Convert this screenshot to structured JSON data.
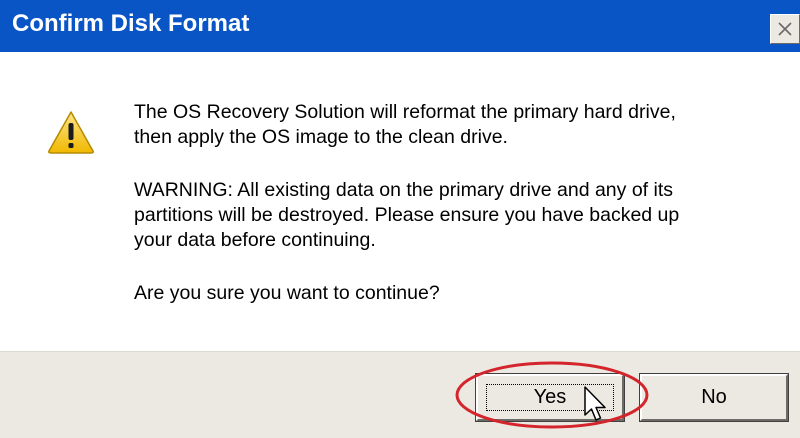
{
  "window": {
    "title": "Confirm Disk Format",
    "close_glyph": "✕"
  },
  "message": {
    "line1": "The OS Recovery Solution will reformat the primary hard drive,",
    "line2": "then apply the OS image to the clean drive.",
    "warning_line1": "WARNING: All existing data on the primary drive and any of its",
    "warning_line2": "partitions will be destroyed. Please ensure you have backed up",
    "warning_line3": "your data before continuing.",
    "question": "Are you sure you want to continue?"
  },
  "buttons": {
    "yes_label": "Yes",
    "no_label": "No"
  },
  "icons": {
    "warning": "warning-triangle-icon",
    "cursor": "mouse-pointer-icon",
    "highlight": "red-highlight-ellipse"
  },
  "colors": {
    "titlebar": "#0a55c6",
    "footer": "#ebe9e2",
    "highlight": "#d4242c",
    "warning_fill": "#f3c21b"
  }
}
